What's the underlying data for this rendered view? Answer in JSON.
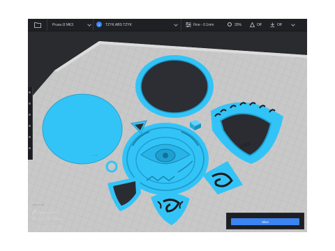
{
  "toolbar": {
    "printer": "Prusa i3 MK3",
    "filament_badge": "1",
    "filament": "TZYK ABS TZYK",
    "quality": "Fine - 0.1mm",
    "infill": "20%",
    "support": "Off",
    "adhesion": "Off"
  },
  "info_panel": {
    "title": "Object list",
    "object_name": "PA4M2_base",
    "dimensions": "187.5 x 167.5 x 2.5 mm"
  },
  "slice_button": {
    "label": "Slice"
  },
  "colors": {
    "model": "#33c4f7",
    "plate": "#c9c9c9",
    "background": "#2a2b2f",
    "toolbar": "#1f2024",
    "accent": "#3b84f1"
  },
  "icons": [
    "folder-icon",
    "filament-icon",
    "sliders-icon",
    "infill-icon",
    "support-icon",
    "adhesion-icon",
    "chevron-down-icon",
    "pencil-icon",
    "view-cube-icon"
  ]
}
